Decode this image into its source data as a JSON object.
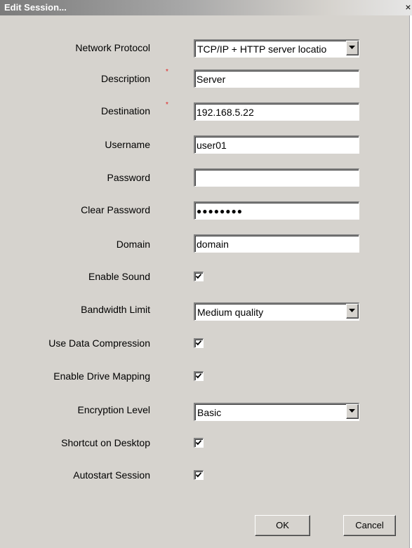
{
  "window": {
    "title": "Edit Session...",
    "close_glyph": "×"
  },
  "form": {
    "network_protocol": {
      "label": "Network Protocol",
      "value": "TCP/IP + HTTP server locatio"
    },
    "description": {
      "label": "Description",
      "value": "Server",
      "required_mark": "*"
    },
    "destination": {
      "label": "Destination",
      "value": "192.168.5.22",
      "required_mark": "*"
    },
    "username": {
      "label": "Username",
      "value": "user01"
    },
    "password": {
      "label": "Password",
      "value": ""
    },
    "clear_password": {
      "label": "Clear Password",
      "value": "●●●●●●●●"
    },
    "domain": {
      "label": "Domain",
      "value": "domain"
    },
    "enable_sound": {
      "label": "Enable Sound",
      "checked": true
    },
    "bandwidth_limit": {
      "label": "Bandwidth Limit",
      "value": "Medium quality"
    },
    "use_data_compression": {
      "label": "Use Data Compression",
      "checked": true
    },
    "enable_drive_mapping": {
      "label": "Enable Drive Mapping",
      "checked": true
    },
    "encryption_level": {
      "label": "Encryption Level",
      "value": "Basic"
    },
    "shortcut_on_desktop": {
      "label": "Shortcut on Desktop",
      "checked": true
    },
    "autostart_session": {
      "label": "Autostart Session",
      "checked": true
    }
  },
  "buttons": {
    "ok_label": "OK",
    "cancel_label": "Cancel"
  },
  "icons": {
    "dropdown": "chevron-down-icon",
    "checkbox": "checkmark-icon",
    "close": "close-icon"
  },
  "colors": {
    "dialog_bg": "#d6d3ce",
    "required_mark": "#e02020"
  }
}
